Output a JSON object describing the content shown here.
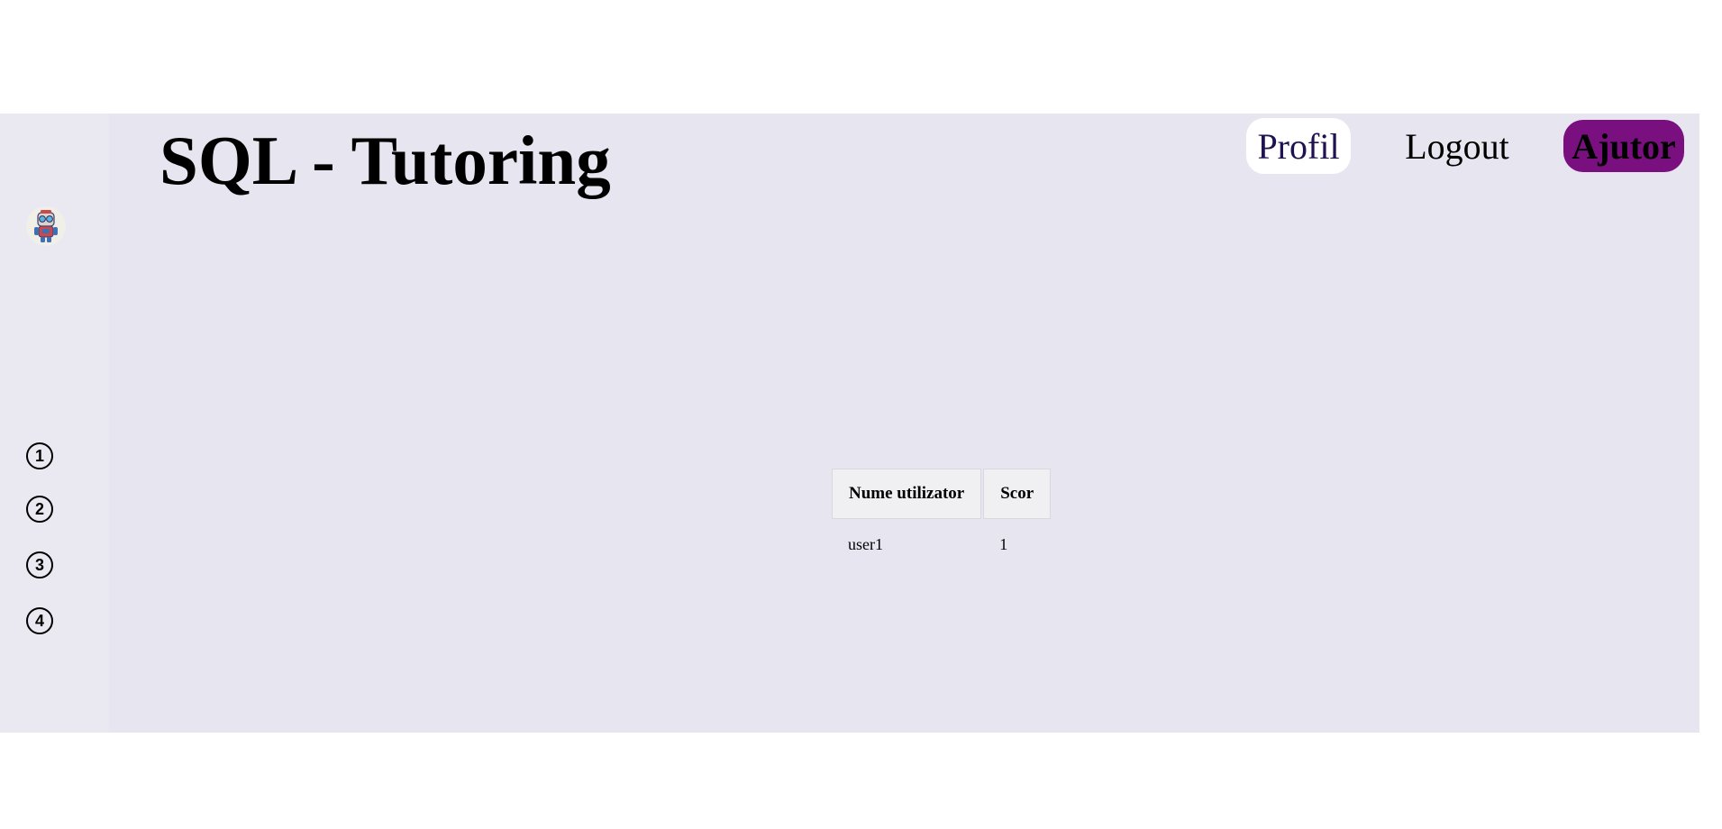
{
  "header": {
    "title": "SQL - Tutoring"
  },
  "nav": {
    "profil": "Profil",
    "logout": "Logout",
    "ajutor": "Ajutor"
  },
  "sidebar": {
    "avatar_icon": "robot-mascot-icon",
    "steps": [
      "1",
      "2",
      "3",
      "4"
    ]
  },
  "table": {
    "headers": [
      "Nume utilizator",
      "Scor"
    ],
    "rows": [
      [
        "user1",
        "1"
      ]
    ]
  },
  "colors": {
    "background": "#e7e6f0",
    "sidebar": "#eae9f1",
    "profil_bg": "#ffffff",
    "ajutor_bg": "#7a0f80"
  }
}
